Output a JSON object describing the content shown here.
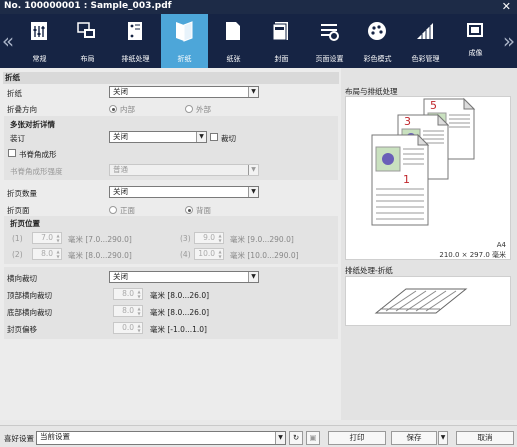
{
  "window": {
    "title": "No. 100000001 : Sample_003.pdf",
    "close": "✕"
  },
  "toolbar": {
    "left_arrow": "«",
    "right_arrow": "»",
    "tabs": [
      {
        "label": "常规",
        "icon": "general-settings-icon"
      },
      {
        "label": "布局",
        "icon": "layout-icon"
      },
      {
        "label": "排纸处理",
        "icon": "finishing-icon"
      },
      {
        "label": "折纸",
        "icon": "folding-icon",
        "active": true
      },
      {
        "label": "纸张",
        "icon": "paper-icon"
      },
      {
        "label": "封面",
        "icon": "cover-icon"
      },
      {
        "label": "页面设置",
        "icon": "page-settings-icon"
      },
      {
        "label": "彩色模式",
        "icon": "color-mode-icon"
      },
      {
        "label": "色彩管理",
        "icon": "color-management-icon"
      },
      {
        "label": "成像",
        "icon": "imaging-icon"
      }
    ],
    "accent": "#4da6d9"
  },
  "fold": {
    "section_title": "折纸",
    "fold_label": "折纸",
    "fold_value": "关闭",
    "direction_label": "折叠方向",
    "direction_options": [
      "内部",
      "外部"
    ],
    "direction_selected": "内部"
  },
  "multi": {
    "title": "多张对折详情",
    "binding_label": "装订",
    "binding_value": "关闭",
    "trim_label": "裁切",
    "book_label": "书脊角成形",
    "book_strength_label": "书脊角成形强度",
    "book_strength_value": "普通"
  },
  "pages": {
    "count_label": "折页数量",
    "count_value": "关闭",
    "face_label": "折页面",
    "face_options": [
      "正面",
      "背面"
    ],
    "face_selected": "背面",
    "position_title": "折页位置",
    "positions": [
      {
        "label": "(1)",
        "value": "7.0",
        "range": "毫米 [7.0...290.0]"
      },
      {
        "label": "(2)",
        "value": "8.0",
        "range": "毫米 [8.0...290.0]"
      },
      {
        "label": "(3)",
        "value": "9.0",
        "range": "毫米 [9.0...290.0]"
      },
      {
        "label": "(4)",
        "value": "10.0",
        "range": "毫米 [10.0...290.0]"
      }
    ]
  },
  "trim": {
    "horiz_label": "横向裁切",
    "horiz_value": "关闭",
    "top_label": "顶部横向裁切",
    "top_value": "8.0",
    "top_range": "毫米 [8.0...26.0]",
    "bottom_label": "底部横向裁切",
    "bottom_value": "8.0",
    "bottom_range": "毫米 [8.0...26.0]",
    "shift_label": "封页偏移",
    "shift_value": "0.0",
    "shift_range": "毫米 [-1.0...1.0]"
  },
  "preview": {
    "layout_title": "布局与排纸处理",
    "page_numbers": [
      "5",
      "3",
      "1"
    ],
    "paper_size": "A4",
    "paper_dims": "210.0 × 297.0 毫米",
    "finish_title": "排纸处理-折纸"
  },
  "bottom": {
    "pref_label": "喜好设置",
    "pref_value": "当前设置",
    "print": "打印",
    "save": "保存",
    "cancel": "取消"
  }
}
